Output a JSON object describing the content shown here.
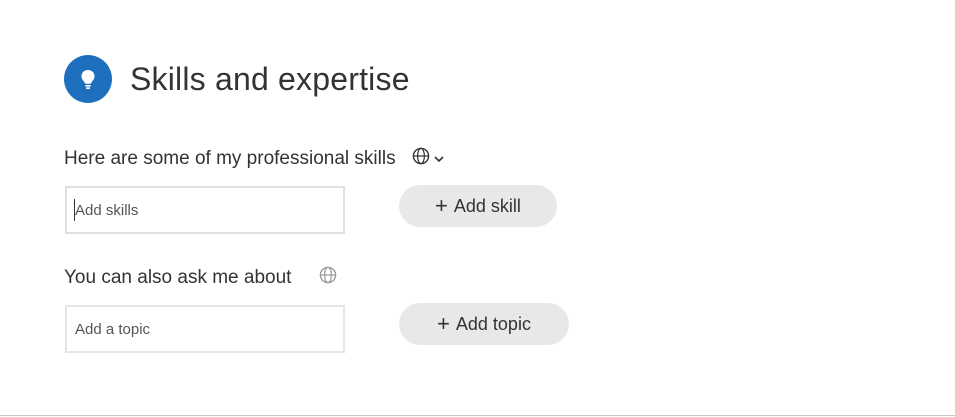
{
  "header": {
    "title": "Skills and expertise",
    "icon": "lightbulb-icon",
    "icon_color": "#1e6fbd"
  },
  "skills": {
    "label": "Here are some of my professional skills",
    "visibility_icon": "globe-icon",
    "visibility_dropdown_icon": "chevron-down-icon",
    "input_placeholder": "Add skills",
    "input_value": "",
    "add_button_symbol": "+",
    "add_button_label": "Add skill"
  },
  "topics": {
    "label": "You can also ask me about",
    "visibility_icon": "globe-icon",
    "input_placeholder": "Add a topic",
    "input_value": "",
    "add_button_symbol": "+",
    "add_button_label": "Add topic"
  }
}
